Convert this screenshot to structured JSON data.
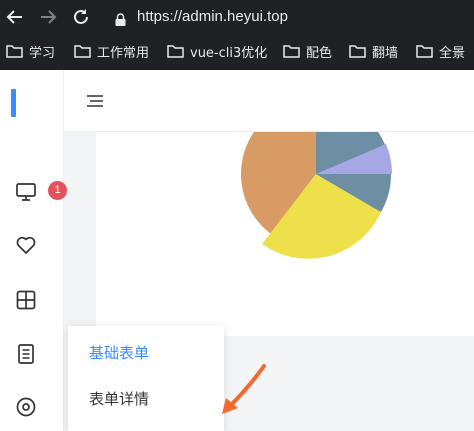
{
  "browser": {
    "url": "https://admin.heyui.top",
    "nav_icons": [
      "back-arrow-icon",
      "forward-arrow-icon",
      "reload-icon",
      "lock-icon"
    ],
    "bookmarks": [
      {
        "label": "学习"
      },
      {
        "label": "工作常用"
      },
      {
        "label": "vue-cli3优化"
      },
      {
        "label": "配色"
      },
      {
        "label": "翻墙"
      },
      {
        "label": "全景"
      }
    ]
  },
  "sidebar": {
    "accent_color": "#3b8cff",
    "items": [
      {
        "icon": "monitor-icon",
        "badge": "1"
      },
      {
        "icon": "heart-icon"
      },
      {
        "icon": "grid-icon"
      },
      {
        "icon": "document-icon"
      },
      {
        "icon": "circle-dot-icon"
      }
    ]
  },
  "header": {
    "icon": "menu-lines-icon"
  },
  "submenu": {
    "items": [
      {
        "label": "基础表单",
        "active": true
      },
      {
        "label": "表单详情",
        "active": false
      }
    ]
  },
  "colors": {
    "chrome_bg": "#202124",
    "active_text": "#3b8cff",
    "badge": "#e4525c",
    "arrow": "#f5692c",
    "pie_slices": [
      "#d79b63",
      "#ede04a",
      "#6e8fa3",
      "#a7a7e6"
    ]
  }
}
